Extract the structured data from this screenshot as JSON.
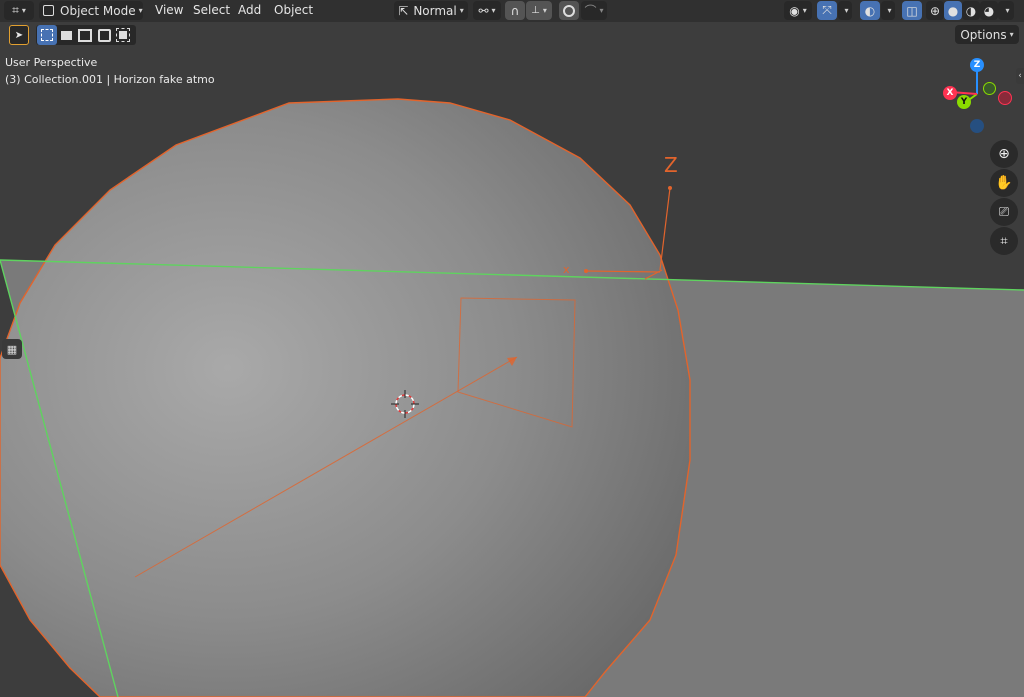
{
  "header": {
    "mode_label": "Object Mode",
    "menus": [
      "View",
      "Select",
      "Add",
      "Object"
    ],
    "orientation_label": "Normal",
    "options_label": "Options"
  },
  "viewport": {
    "view_name": "User Perspective",
    "collection_info": "(3) Collection.001 | Horizon fake atmo"
  },
  "gizmo": {
    "axis_labels": {
      "x": "X",
      "y": "Y",
      "z": "Z"
    },
    "empty_label": "Z"
  },
  "colors": {
    "header_bg": "#303030",
    "viewport_bg": "#3d3d3d",
    "selection_orange": "#e2642c",
    "plane_green": "#5fd35f",
    "active_blue": "#4772b3",
    "axis_x": "#ff3352",
    "axis_y": "#8bdc00",
    "axis_z": "#2890ff"
  },
  "icons": {
    "editor_type": "grid-editor-icon",
    "mode": "object-mode-icon",
    "transform_orientation": "transform-orientation-icon",
    "pivot": "pivot-point-icon",
    "snap": "magnet-snap-icon",
    "snap_target": "snap-increment-icon",
    "proportional": "proportional-edit-icon",
    "falloff": "falloff-curve-icon",
    "visibility": "eye-visibility-icon",
    "gizmos": "gizmo-arrows-icon",
    "overlays": "overlays-icon",
    "xray": "xray-icon",
    "shading": [
      "wireframe-shading-icon",
      "solid-shading-icon",
      "material-shading-icon",
      "rendered-shading-icon"
    ],
    "nav": [
      "zoom-icon",
      "pan-hand-icon",
      "camera-view-icon",
      "ortho-grid-icon"
    ]
  }
}
